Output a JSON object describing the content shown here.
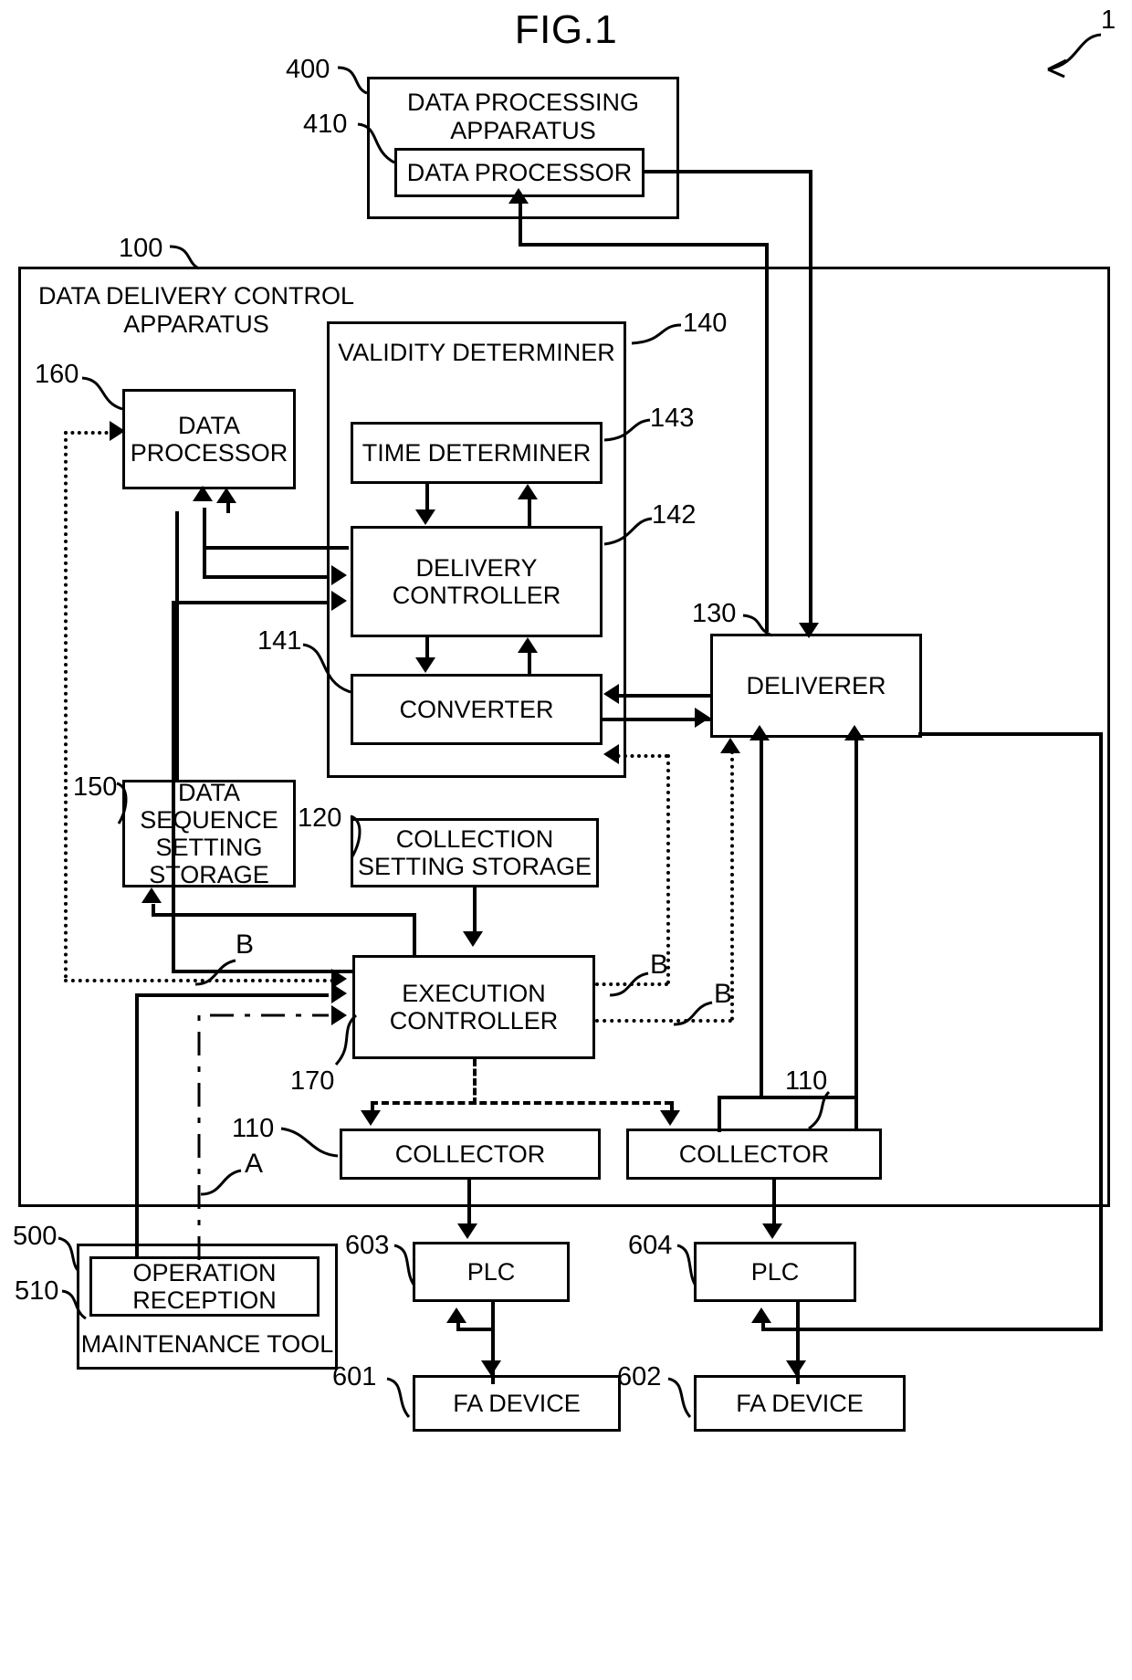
{
  "figure": {
    "title": "FIG.1",
    "system_ref": "1"
  },
  "blocks": {
    "data_processing_apparatus": {
      "label": "DATA PROCESSING\nAPPARATUS",
      "ref": "400"
    },
    "external_data_processor": {
      "label": "DATA PROCESSOR",
      "ref": "410"
    },
    "data_delivery_control_apparatus": {
      "label": "DATA DELIVERY CONTROL\nAPPARATUS",
      "ref": "100"
    },
    "internal_data_processor": {
      "label": "DATA\nPROCESSOR",
      "ref": "160"
    },
    "validity_determiner": {
      "label": "VALIDITY DETERMINER",
      "ref": "140"
    },
    "time_determiner": {
      "label": "TIME DETERMINER",
      "ref": "143"
    },
    "delivery_controller": {
      "label": "DELIVERY\nCONTROLLER",
      "ref": "142"
    },
    "converter": {
      "label": "CONVERTER",
      "ref": "141"
    },
    "deliverer": {
      "label": "DELIVERER",
      "ref": "130"
    },
    "data_sequence_setting_storage": {
      "label": "DATA\nSEQUENCE\nSETTING\nSTORAGE",
      "ref": "150"
    },
    "collection_setting_storage": {
      "label": "COLLECTION\nSETTING STORAGE",
      "ref": "120"
    },
    "execution_controller": {
      "label": "EXECUTION\nCONTROLLER",
      "ref": "170"
    },
    "collector_left": {
      "label": "COLLECTOR",
      "ref": "110"
    },
    "collector_right": {
      "label": "COLLECTOR",
      "ref": "110"
    },
    "maintenance_tool": {
      "label": "MAINTENANCE TOOL",
      "ref": "500"
    },
    "operation_reception": {
      "label": "OPERATION\nRECEPTION",
      "ref": "510"
    },
    "plc_left": {
      "label": "PLC",
      "ref": "603"
    },
    "plc_right": {
      "label": "PLC",
      "ref": "604"
    },
    "fa_device_left": {
      "label": "FA DEVICE",
      "ref": "601"
    },
    "fa_device_right": {
      "label": "FA DEVICE",
      "ref": "602"
    }
  },
  "signal_labels": {
    "a": "A",
    "b1": "B",
    "b2": "B",
    "b3": "B"
  },
  "colors": {
    "stroke": "#000000",
    "background": "#ffffff"
  }
}
